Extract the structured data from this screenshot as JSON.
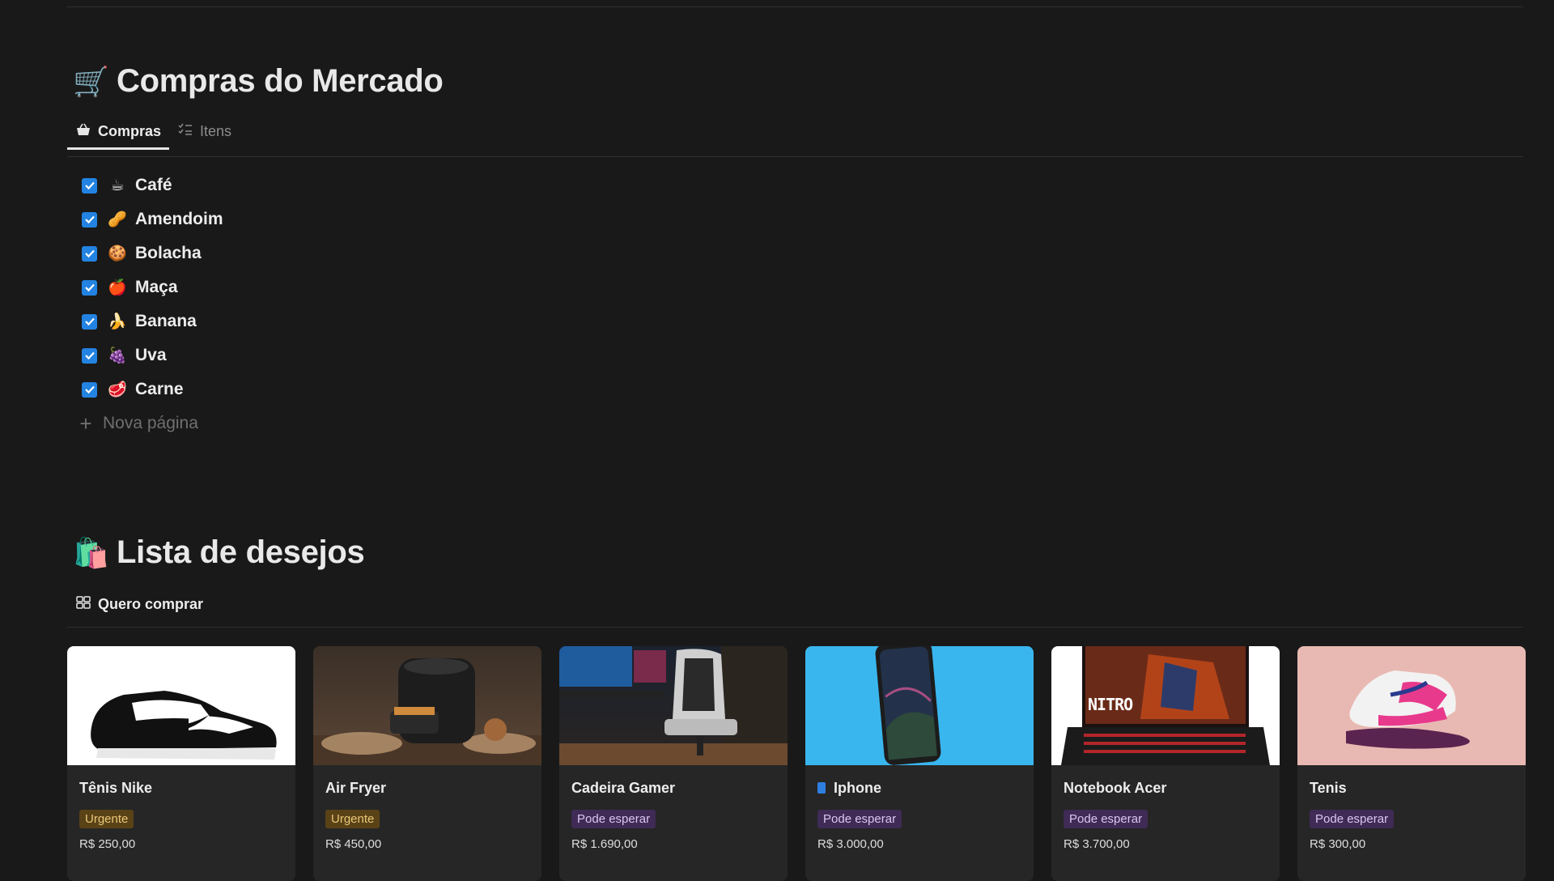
{
  "market": {
    "title": "Compras do Mercado",
    "title_icon": "shopping-cart-icon",
    "tabs": [
      {
        "label": "Compras",
        "icon": "basket-icon",
        "active": true
      },
      {
        "label": "Itens",
        "icon": "checklist-icon",
        "active": false
      }
    ],
    "items": [
      {
        "label": "Café",
        "emoji": "☕",
        "checked": true
      },
      {
        "label": "Amendoim",
        "emoji": "🥜",
        "checked": true
      },
      {
        "label": "Bolacha",
        "emoji": "🍪",
        "checked": true
      },
      {
        "label": "Maça",
        "emoji": "🍎",
        "checked": true
      },
      {
        "label": "Banana",
        "emoji": "🍌",
        "checked": true
      },
      {
        "label": "Uva",
        "emoji": "🍇",
        "checked": true
      },
      {
        "label": "Carne",
        "emoji": "🥩",
        "checked": true
      }
    ],
    "new_page_label": "Nova página"
  },
  "wishlist": {
    "title": "Lista de desejos",
    "title_icon": "shopping-bags-icon",
    "view_label": "Quero comprar",
    "view_icon": "gallery-grid-icon",
    "cards": [
      {
        "title": "Tênis Nike",
        "tag": "Urgente",
        "tag_type": "urgent",
        "price": "R$ 250,00"
      },
      {
        "title": "Air Fryer",
        "tag": "Urgente",
        "tag_type": "urgent",
        "price": "R$ 450,00"
      },
      {
        "title": "Cadeira Gamer",
        "tag": "Pode esperar",
        "tag_type": "wait",
        "price": "R$ 1.690,00"
      },
      {
        "title": "Iphone",
        "tag": "Pode esperar",
        "tag_type": "wait",
        "price": "R$ 3.000,00"
      },
      {
        "title": "Notebook Acer",
        "tag": "Pode esperar",
        "tag_type": "wait",
        "price": "R$ 3.700,00",
        "image_text": "NITRO"
      },
      {
        "title": "Tenis",
        "tag": "Pode esperar",
        "tag_type": "wait",
        "price": "R$ 300,00"
      }
    ]
  },
  "colors": {
    "background": "#191919",
    "checkbox": "#2383e2",
    "urgent_tag_bg": "#5a4217",
    "wait_tag_bg": "#3f2b55"
  }
}
